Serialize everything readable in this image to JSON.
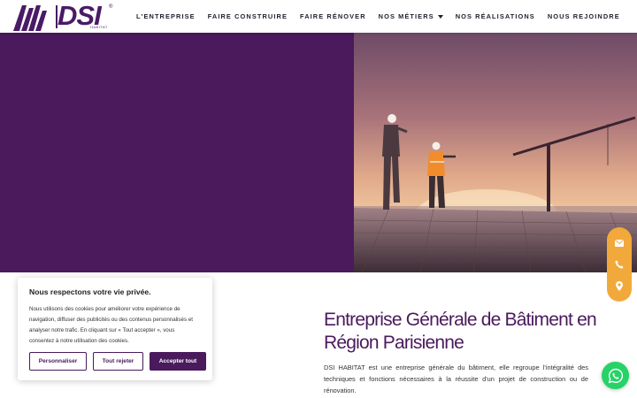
{
  "brand": {
    "name": "DSI",
    "sub": "HABITAT",
    "reg": "®"
  },
  "nav": {
    "items": [
      {
        "label": "L'ENTREPRISE"
      },
      {
        "label": "FAIRE CONSTRUIRE"
      },
      {
        "label": "FAIRE RÉNOVER"
      },
      {
        "label": "NOS MÉTIERS",
        "dropdown": true
      },
      {
        "label": "NOS RÉALISATIONS"
      },
      {
        "label": "NOUS REJOINDRE"
      }
    ]
  },
  "colors": {
    "brand_purple": "#4a1a5c",
    "accent_orange": "#f2a93b",
    "whatsapp_green": "#25d366"
  },
  "side_contact": {
    "icons": [
      "envelope-icon",
      "phone-icon",
      "map-pin-icon"
    ]
  },
  "cookie": {
    "title": "Nous respectons votre vie privée.",
    "text": "Nous utilisons des cookies pour améliorer votre expérience de navigation, diffuser des publicités ou des contenus personnalisés et analyser notre trafic. En cliquant sur « Tout accepter », vous consentez à notre utilisation des cookies.",
    "customize_label": "Personnaliser",
    "reject_label": "Tout rejeter",
    "accept_label": "Accepter tout"
  },
  "section": {
    "title": "Entreprise Générale de Bâtiment en Région Parisienne",
    "description": "DSI HABITAT est une entreprise générale du bâtiment, elle regroupe l'intégralité des techniques et fonctions nécessaires à la réussite d'un projet de construction ou de rénovation."
  }
}
